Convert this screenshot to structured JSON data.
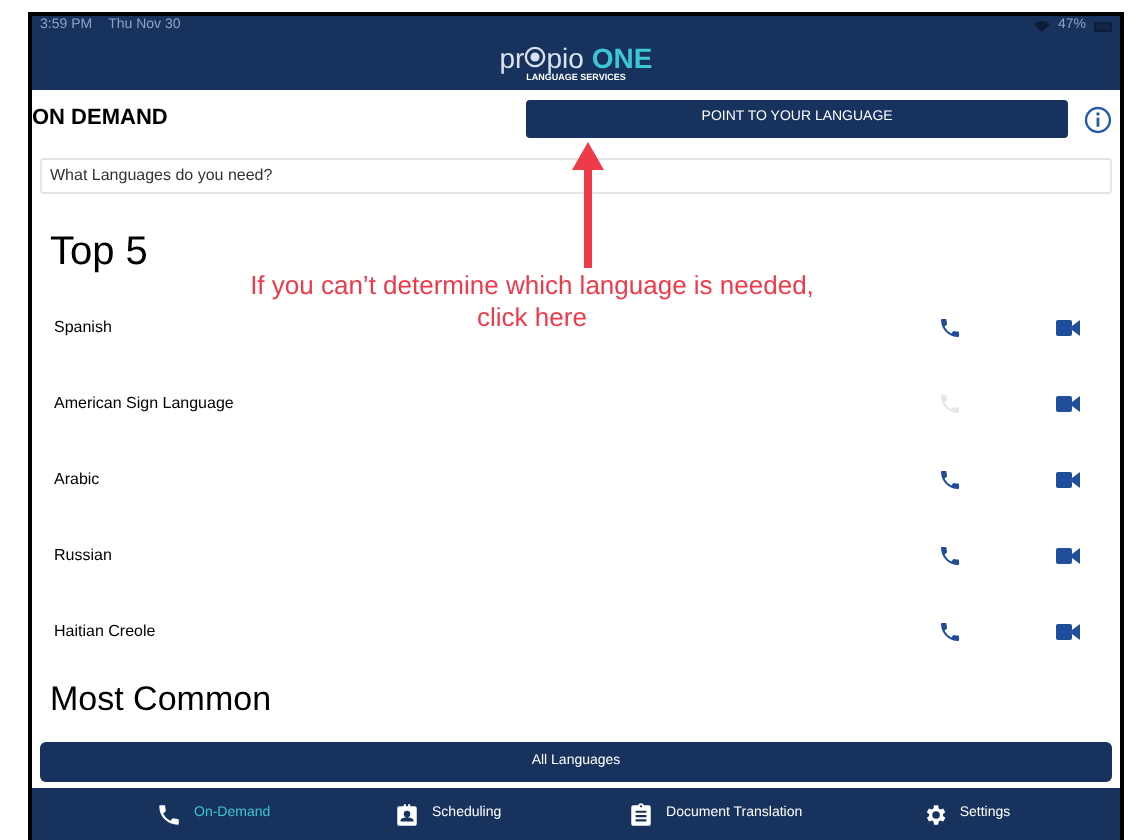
{
  "status_bar": {
    "time": "3:59 PM",
    "date": "Thu Nov 30",
    "battery": "47%"
  },
  "header": {
    "logo_start": "pr",
    "logo_end": "pio",
    "logo_brand": "ONE",
    "logo_subtitle": "LANGUAGE SERVICES"
  },
  "page_title": "ON DEMAND",
  "point_button": "POINT TO YOUR LANGUAGE",
  "search": {
    "placeholder": "What Languages do you need?"
  },
  "top_heading": "Top 5",
  "languages": [
    {
      "name": "Spanish",
      "phone_enabled": true
    },
    {
      "name": "American Sign Language",
      "phone_enabled": false
    },
    {
      "name": "Arabic",
      "phone_enabled": true
    },
    {
      "name": "Russian",
      "phone_enabled": true
    },
    {
      "name": "Haitian Creole",
      "phone_enabled": true
    }
  ],
  "common_heading": "Most Common",
  "all_button": "All Languages",
  "tabs": [
    {
      "label": "On-Demand",
      "kind": "calls",
      "selected": true
    },
    {
      "label": "Scheduling",
      "kind": "schedule",
      "selected": false
    },
    {
      "label": "Document Translation",
      "kind": "documents",
      "selected": false
    },
    {
      "label": "Settings",
      "kind": "settings",
      "selected": false
    }
  ],
  "annotation": {
    "text": "If you can’t determine which language is needed, click here"
  }
}
